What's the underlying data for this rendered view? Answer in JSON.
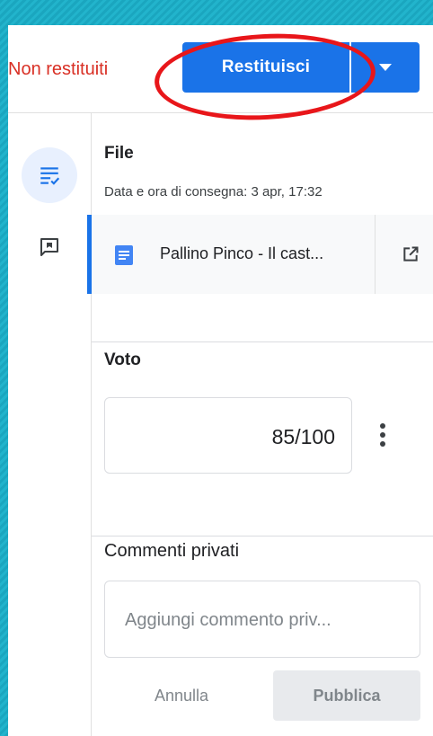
{
  "header": {
    "status_text": "Non restituiti",
    "return_button_label": "Restituisci"
  },
  "sidebar": {
    "items": [
      {
        "icon": "assignment-list-icon",
        "active": true
      },
      {
        "icon": "comment-icon",
        "active": false
      }
    ]
  },
  "file_section": {
    "title": "File",
    "submitted_at": "Data e ora di consegna: 3 apr, 17:32",
    "attachment": {
      "name": "Pallino Pinco - Il cast...",
      "icon": "google-doc-icon"
    }
  },
  "grade_section": {
    "label": "Voto",
    "value": "85/100"
  },
  "comments_section": {
    "label": "Commenti privati",
    "placeholder": "Aggiungi commento priv...",
    "cancel_label": "Annulla",
    "publish_label": "Pubblica"
  },
  "colors": {
    "accent": "#1a73e8",
    "status": "#d93025",
    "annotation": "#e8161a",
    "background": "#1aa6bf"
  }
}
